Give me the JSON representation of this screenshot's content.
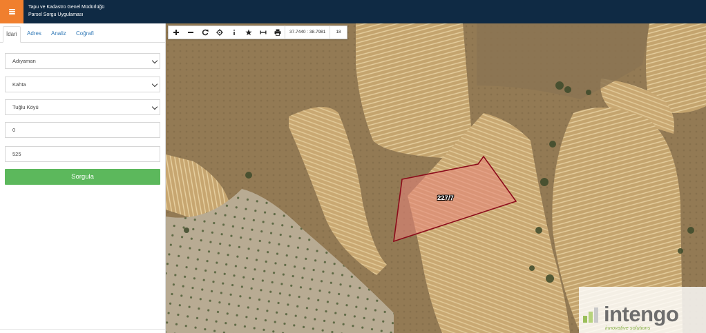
{
  "header": {
    "menu_icon": "hamburger-icon",
    "title_line1": "Tapu ve Kadastro Genel Müdürlüğü",
    "title_line2": "Parsel Sorgu Uygulaması",
    "colors": {
      "bar": "#0f2a44",
      "menu": "#f07f2e"
    }
  },
  "sidebar": {
    "tabs": [
      {
        "label": "İdari",
        "active": true
      },
      {
        "label": "Adres",
        "active": false
      },
      {
        "label": "Analiz",
        "active": false
      },
      {
        "label": "Coğrafi",
        "active": false
      }
    ],
    "form": {
      "il": "Adıyaman",
      "ilce": "Kahta",
      "mahalle": "Tuğlu Köyü",
      "ada": "0",
      "parsel": "525",
      "submit_label": "Sorgula",
      "submit_color": "#5cb85c"
    }
  },
  "map": {
    "toolbar": {
      "tools": [
        "zoom-in-icon",
        "zoom-out-icon",
        "refresh-icon",
        "locate-icon",
        "info-icon",
        "star-icon",
        "measure-icon",
        "print-icon"
      ],
      "coordinates": "37.7440 : 38.7981",
      "zoom_level": "18"
    },
    "parcel_label": "227/7",
    "parcel_colors": {
      "fill": "#e8847a",
      "stroke": "#8b0a1a"
    },
    "watermark": {
      "brand": "intengo",
      "tagline": "innovative solutions"
    }
  }
}
